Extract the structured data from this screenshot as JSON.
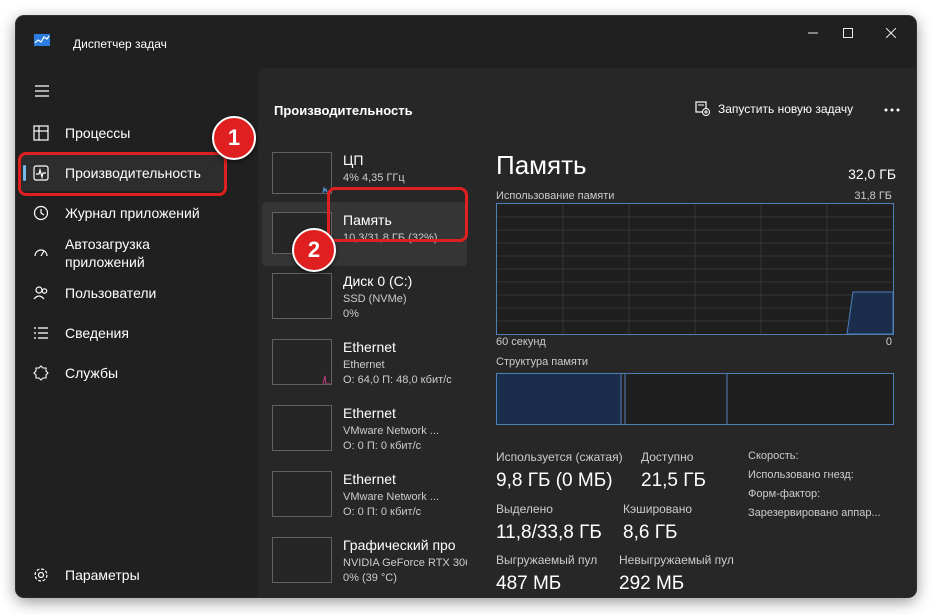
{
  "window": {
    "title": "Диспетчер задач"
  },
  "sidebar": {
    "items": [
      {
        "label": "Процессы",
        "icon": "processes-icon"
      },
      {
        "label": "Производительность",
        "icon": "performance-icon",
        "active": true
      },
      {
        "label": "Журнал приложений",
        "icon": "history-icon"
      },
      {
        "label": "Автозагрузка приложений",
        "icon": "startup-icon"
      },
      {
        "label": "Пользователи",
        "icon": "users-icon"
      },
      {
        "label": "Сведения",
        "icon": "details-icon"
      },
      {
        "label": "Службы",
        "icon": "services-icon"
      }
    ],
    "settings": {
      "label": "Параметры",
      "icon": "gear-icon"
    }
  },
  "header": {
    "title": "Производительность",
    "run_task_label": "Запустить новую задачу"
  },
  "resources": [
    {
      "name": "ЦП",
      "sub1": "4% 4,35 ГГц",
      "sub2": ""
    },
    {
      "name": "Память",
      "sub1": "10,3/31,8 ГБ (32%)",
      "sub2": ""
    },
    {
      "name": "Диск 0 (C:)",
      "sub1": "SSD (NVMe)",
      "sub2": "0%"
    },
    {
      "name": "Ethernet",
      "sub1": "Ethernet",
      "sub2": "О: 64,0 П: 48,0 кбит/с"
    },
    {
      "name": "Ethernet",
      "sub1": "VMware Network ...",
      "sub2": "О: 0 П: 0 кбит/с"
    },
    {
      "name": "Ethernet",
      "sub1": "VMware Network ...",
      "sub2": "О: 0 П: 0 кбит/с"
    },
    {
      "name": "Графический про",
      "sub1": "NVIDIA GeForce RTX 306",
      "sub2": "0% (39 °C)"
    }
  ],
  "detail": {
    "title": "Память",
    "total": "32,0 ГБ",
    "usage_label": "Использование памяти",
    "usage_max": "31,8 ГБ",
    "time_left": "60 секунд",
    "time_right": "0",
    "structure_label": "Структура памяти",
    "stats": [
      {
        "label": "Используется (сжатая)",
        "value": "9,8 ГБ (0 МБ)"
      },
      {
        "label": "Доступно",
        "value": "21,5 ГБ"
      },
      {
        "label": "Выделено",
        "value": "11,8/33,8 ГБ"
      },
      {
        "label": "Кэшировано",
        "value": "8,6 ГБ"
      },
      {
        "label": "Выгружаемый пул",
        "value": "487 МБ"
      },
      {
        "label": "Невыгружаемый пул",
        "value": "292 МБ"
      }
    ],
    "right_labels": [
      "Скорость:",
      "Использовано гнезд:",
      "Форм-фактор:",
      "Зарезервировано аппар..."
    ]
  },
  "callouts": {
    "first": "1",
    "second": "2"
  },
  "colors": {
    "accent": "#76b9ed",
    "graph_border": "#4f7fb8",
    "callout": "#e02020"
  }
}
